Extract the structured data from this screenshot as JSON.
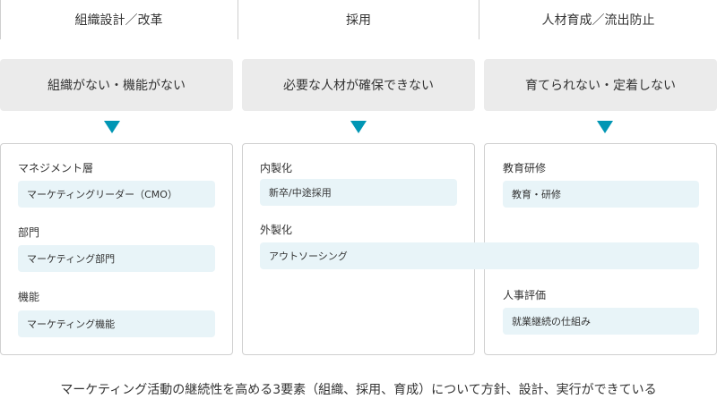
{
  "headers": [
    "組織設計／改革",
    "採用",
    "人材育成／流出防止"
  ],
  "problems": [
    "組織がない・機能がない",
    "必要な人材が確保できない",
    "育てられない・定着しない"
  ],
  "col1": {
    "label1": "マネジメント層",
    "item1": "マーケティングリーダー（CMO）",
    "label2": "部門",
    "item2": "マーケティング部門",
    "label3": "機能",
    "item3": "マーケティング機能"
  },
  "col2": {
    "label1": "内製化",
    "item1": "新卒/中途採用",
    "label2": "外製化",
    "item2": "アウトソーシング"
  },
  "col3": {
    "label1": "教育研修",
    "item1": "教育・研修",
    "label2": "人事評価",
    "item2": "就業継続の仕組み"
  },
  "footer": "マーケティング活動の継続性を高める3要素（組織、採用、育成）について方針、設計、実行ができている",
  "colors": {
    "accent": "#0096b4",
    "pill_bg": "#e8f4f8",
    "problem_bg": "#ebebeb",
    "border": "#d0d0d0"
  }
}
